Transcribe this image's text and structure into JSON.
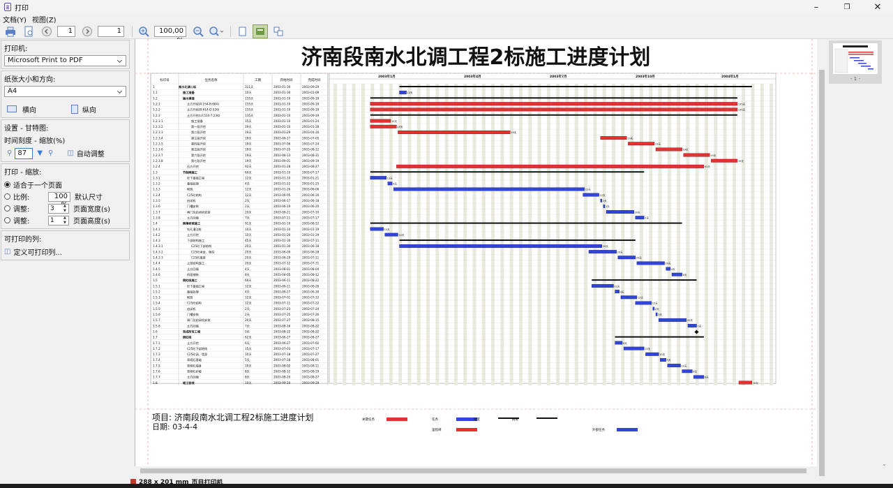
{
  "window": {
    "title": "打印",
    "minimize": "–",
    "restore": "❐",
    "close": "✕"
  },
  "menu": [
    "文档(Y)",
    "视图(Z)"
  ],
  "toolbar": {
    "page_from": "1",
    "page_to": "1",
    "zoom": "100,00 %"
  },
  "sidebar": {
    "printer_label": "打印机:",
    "printer_value": "Microsoft Print to PDF",
    "paper_label": "纸张大小和方向:",
    "paper_value": "A4",
    "landscape": "横向",
    "portrait": "纵向",
    "gantt_label": "设置 - 甘特图:",
    "time_scale_label": "时间刻度 - 缩放(%)",
    "time_scale_value": "87",
    "auto_adjust": "自动调整",
    "print_zoom_label": "打印 - 缩放:",
    "fit_one_page": "适合于一个页面",
    "ratio_label": "比例:",
    "ratio_value": "100 %",
    "default_size": "默认尺寸",
    "adjust1_label": "调整:",
    "adjust1_value": "3",
    "page_width": "页面宽度(s)",
    "adjust2_label": "调整:",
    "adjust2_value": "1",
    "page_height": "页面高度(s)",
    "printable_cols_label": "可打印的列:",
    "define_cols": "定义可打印列..."
  },
  "document": {
    "title": "济南段南水北调工程2标施工进度计划",
    "footer_project": "项目: 济南段南水北调工程2标施工进度计划",
    "footer_date": "日期: 03-4-4",
    "columns": [
      "标识号",
      "任务名称",
      "工期",
      "开始时间",
      "完成时间"
    ],
    "timeline": [
      "2003年1月",
      "2003年4月",
      "2003年7月",
      "2003年10月",
      "2004年1月"
    ],
    "legend": [
      "关键任务",
      "任务",
      "进度",
      "摘要",
      "里程碑",
      "外部任务"
    ],
    "rows": [
      {
        "id": "1",
        "name": "南水北调二标",
        "dur": "311天",
        "start": "2003-01-30",
        "end": "2003-09-29"
      },
      {
        "id": "1.1",
        "name": "施工准备",
        "dur": "10天",
        "start": "2003-01-30",
        "end": "2003-01-09"
      },
      {
        "id": "1.2",
        "name": "输水渠道",
        "dur": "135天",
        "start": "2003-01-10",
        "end": "2003-09-19"
      },
      {
        "id": "1.2.1",
        "name": "土方开挖(A:234-B:684)",
        "dur": "135天",
        "start": "2003-01-10",
        "end": "2003-09-19"
      },
      {
        "id": "1.2.2",
        "name": "土方开挖(B:614-D:526)",
        "dur": "135天",
        "start": "2003-01-10",
        "end": "2003-09-19"
      },
      {
        "id": "1.2.3",
        "name": "土方开挖(LF:534-7:234)",
        "dur": "135天",
        "start": "2003-01-10",
        "end": "2003-09-19"
      },
      {
        "id": "1.2.3.1",
        "name": "施工准备",
        "dur": "15天",
        "start": "2003-01-10",
        "end": "2003-01-24"
      },
      {
        "id": "1.2.3.2",
        "name": "第一段开挖",
        "dur": "19天",
        "start": "2003-01-10",
        "end": "2003-01-28"
      },
      {
        "id": "1.2.3.3",
        "name": "第二段开挖",
        "dur": "19天",
        "start": "2003-01-29",
        "end": "2003-04-16"
      },
      {
        "id": "1.2.3.4",
        "name": "第三段开挖",
        "dur": "19天",
        "start": "2003-06-17",
        "end": "2003-07-05"
      },
      {
        "id": "1.2.3.5",
        "name": "第四段开挖",
        "dur": "19天",
        "start": "2003-07-06",
        "end": "2003-07-24"
      },
      {
        "id": "1.2.3.6",
        "name": "第五段开挖",
        "dur": "19天",
        "start": "2003-07-25",
        "end": "2003-08-12"
      },
      {
        "id": "1.2.3.7",
        "name": "第六段开挖",
        "dur": "19天",
        "start": "2003-08-13",
        "end": "2003-08-31"
      },
      {
        "id": "1.2.3.8",
        "name": "第七段开挖",
        "dur": "19天",
        "start": "2003-09-01",
        "end": "2003-09-19"
      },
      {
        "id": "1.2.4",
        "name": "石方开挖",
        "dur": "92天",
        "start": "2003-01-28",
        "end": "2003-08-27"
      },
      {
        "id": "1.3",
        "name": "节制闸施工",
        "dur": "69天",
        "start": "2003-01-10",
        "end": "2003-07-17"
      },
      {
        "id": "1.3.1",
        "name": "砼下基础工程",
        "dur": "12天",
        "start": "2003-01-10",
        "end": "2003-01-21"
      },
      {
        "id": "1.3.2",
        "name": "基础处理",
        "dur": "4天",
        "start": "2003-01-22",
        "end": "2003-01-25"
      },
      {
        "id": "1.3.3",
        "name": "砌筑",
        "dur": "12天",
        "start": "2003-01-26",
        "end": "2003-06-06"
      },
      {
        "id": "1.3.4",
        "name": "C25砼结构",
        "dur": "12天",
        "start": "2003-06-05",
        "end": "2003-06-16"
      },
      {
        "id": "1.3.5",
        "name": "启闭机",
        "dur": "2天",
        "start": "2003-06-17",
        "end": "2003-06-18"
      },
      {
        "id": "1.3.6",
        "name": "门槽安装",
        "dur": "2天",
        "start": "2003-06-19",
        "end": "2003-06-20"
      },
      {
        "id": "1.3.7",
        "name": "闸门及启闭机安装",
        "dur": "20天",
        "start": "2003-06-21",
        "end": "2003-07-10"
      },
      {
        "id": "1.3.8",
        "name": "土方回填",
        "dur": "7天",
        "start": "2003-07-11",
        "end": "2003-07-17"
      },
      {
        "id": "1.4",
        "name": "跨渠桥梁施工",
        "dur": "91天",
        "start": "2003-01-10",
        "end": "2003-08-12"
      },
      {
        "id": "1.4.1",
        "name": "钻孔灌注桩",
        "dur": "10天",
        "start": "2003-01-10",
        "end": "2003-01-19"
      },
      {
        "id": "1.4.2",
        "name": "土方开挖",
        "dur": "10天",
        "start": "2003-01-20",
        "end": "2003-01-29"
      },
      {
        "id": "1.4.3",
        "name": "下部结构施工",
        "dur": "45天",
        "start": "2003-01-30",
        "end": "2003-07-11"
      },
      {
        "id": "1.4.3.1",
        "name": "C25砼下部结构",
        "dur": "20天",
        "start": "2003-01-30",
        "end": "2003-06-18"
      },
      {
        "id": "1.4.3.2",
        "name": "C25砼承台、墩柱",
        "dur": "20天",
        "start": "2003-06-09",
        "end": "2003-06-28"
      },
      {
        "id": "1.4.3.3",
        "name": "C25砼盖梁",
        "dur": "20天",
        "start": "2003-06-29",
        "end": "2003-07-11"
      },
      {
        "id": "1.4.4",
        "name": "上部结构施工",
        "dur": "20天",
        "start": "2003-07-12",
        "end": "2003-07-31"
      },
      {
        "id": "1.4.5",
        "name": "土方回填",
        "dur": "4天",
        "start": "2003-08-01",
        "end": "2003-08-04"
      },
      {
        "id": "1.4.6",
        "name": "桥面铺装",
        "dur": "8天",
        "start": "2003-08-05",
        "end": "2003-08-12"
      },
      {
        "id": "1.5",
        "name": "倒虹吸施工",
        "dur": "69天",
        "start": "2003-06-11",
        "end": "2003-08-22"
      },
      {
        "id": "1.5.1",
        "name": "砼下基础工程",
        "dur": "12天",
        "start": "2003-06-11",
        "end": "2003-06-26"
      },
      {
        "id": "1.5.2",
        "name": "基础处理",
        "dur": "4天",
        "start": "2003-06-27",
        "end": "2003-06-30"
      },
      {
        "id": "1.5.3",
        "name": "砌筑",
        "dur": "12天",
        "start": "2003-07-01",
        "end": "2003-07-12"
      },
      {
        "id": "1.5.4",
        "name": "C25砼结构",
        "dur": "12天",
        "start": "2003-07-11",
        "end": "2003-07-22"
      },
      {
        "id": "1.5.5",
        "name": "启闭机",
        "dur": "2天",
        "start": "2003-07-23",
        "end": "2003-07-24"
      },
      {
        "id": "1.5.6",
        "name": "门槽安装",
        "dur": "2天",
        "start": "2003-07-25",
        "end": "2003-07-26"
      },
      {
        "id": "1.5.7",
        "name": "闸门及启闭机安装",
        "dur": "20天",
        "start": "2003-07-27",
        "end": "2003-08-15"
      },
      {
        "id": "1.5.8",
        "name": "土方回填",
        "dur": "7天",
        "start": "2003-08-16",
        "end": "2003-08-22"
      },
      {
        "id": "1.6",
        "name": "完成所有工程",
        "dur": "0天",
        "start": "2003-08-22",
        "end": "2003-08-22"
      },
      {
        "id": "1.7",
        "name": "倒虹吸",
        "dur": "62天",
        "start": "2003-06-27",
        "end": "2003-08-27"
      },
      {
        "id": "1.7.1",
        "name": "土方开挖",
        "dur": "6天",
        "start": "2003-06-27",
        "end": "2003-07-02"
      },
      {
        "id": "1.7.2",
        "name": "C25砼下部结构",
        "dur": "15天",
        "start": "2003-07-03",
        "end": "2003-07-17"
      },
      {
        "id": "1.7.3",
        "name": "C25砼涵、墙身",
        "dur": "10天",
        "start": "2003-07-18",
        "end": "2003-07-27"
      },
      {
        "id": "1.7.4",
        "name": "浆砌石基础",
        "dur": "5天",
        "start": "2003-07-28",
        "end": "2003-08-01"
      },
      {
        "id": "1.7.5",
        "name": "浆砌石墙身",
        "dur": "10天",
        "start": "2003-08-02",
        "end": "2003-08-11"
      },
      {
        "id": "1.7.6",
        "name": "浆砌石护坡",
        "dur": "8天",
        "start": "2003-08-12",
        "end": "2003-08-19"
      },
      {
        "id": "1.7.7",
        "name": "土方回填",
        "dur": "8天",
        "start": "2003-08-20",
        "end": "2003-08-27"
      },
      {
        "id": "1.8",
        "name": "竣工验收",
        "dur": "10天",
        "start": "2003-09-20",
        "end": "2003-09-29"
      }
    ]
  },
  "status": {
    "paper_size": "288 x 201 mm",
    "printer_status": "页目打印机"
  },
  "thumbnail_label": "- 1 -"
}
